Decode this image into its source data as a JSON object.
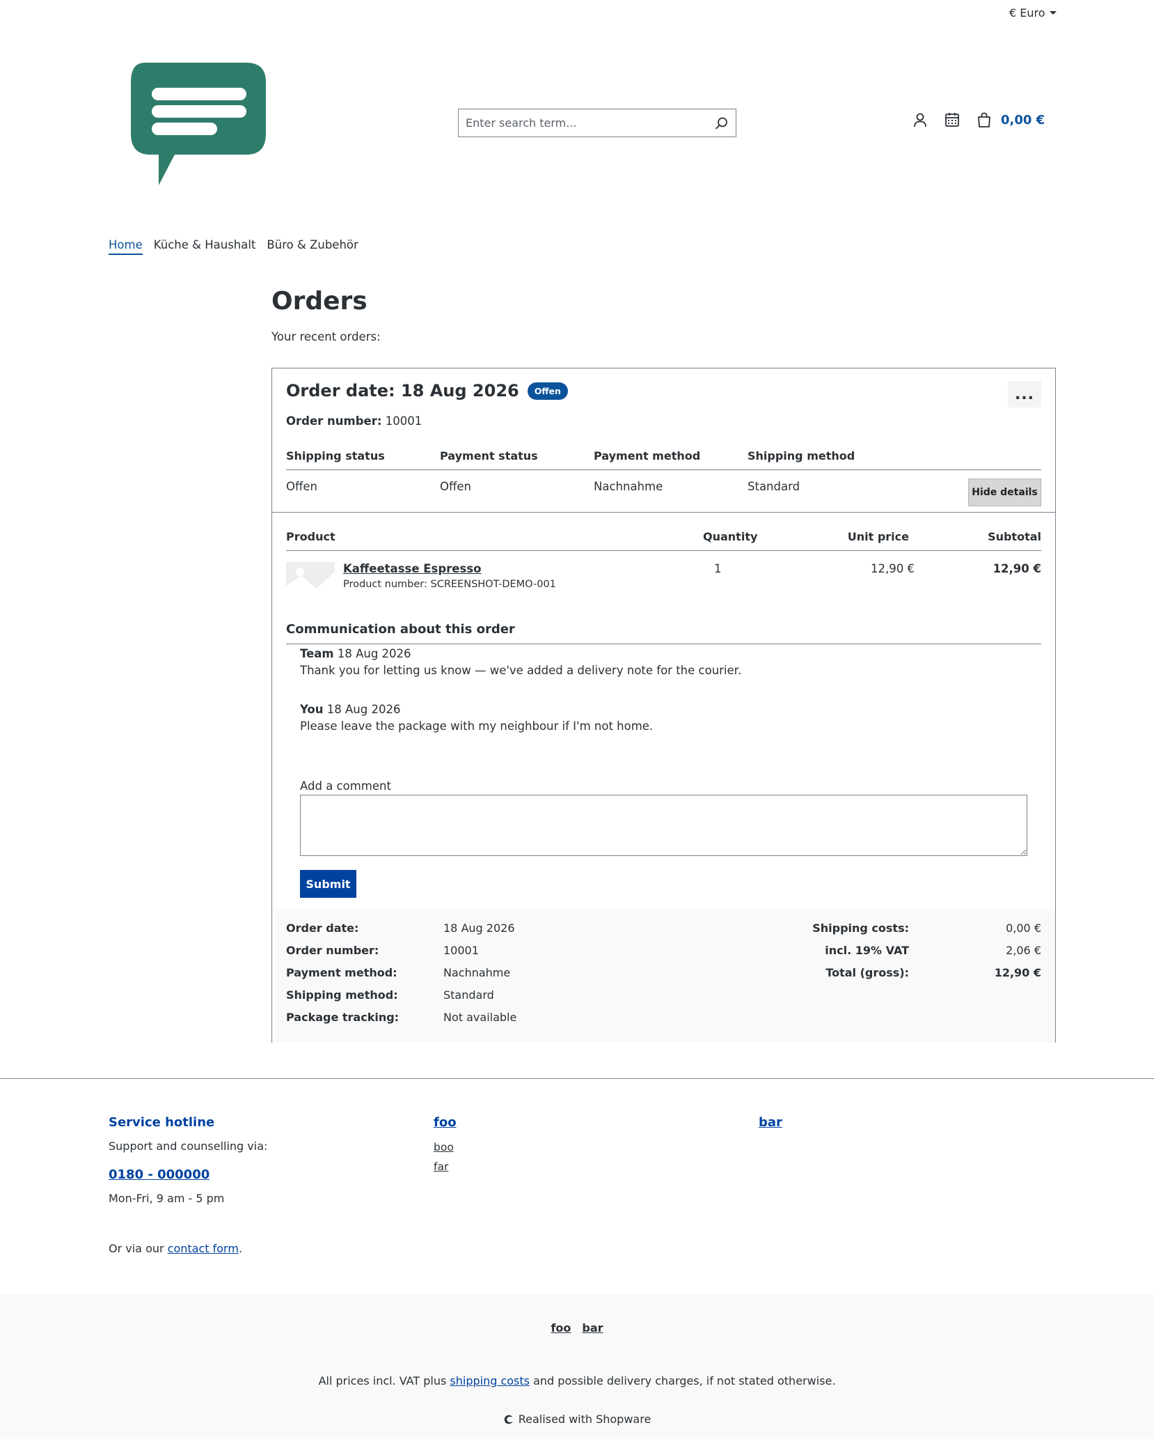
{
  "topbar": {
    "currency": "€ Euro"
  },
  "header": {
    "search_placeholder": "Enter search term...",
    "cart_total": "0,00 €"
  },
  "nav": {
    "items": [
      "Home",
      "Küche & Haushalt",
      "Büro & Zubehör"
    ]
  },
  "page": {
    "title": "Orders",
    "subtitle": "Your recent orders:"
  },
  "order": {
    "date_heading": "Order date: 18 Aug 2026",
    "status_badge": "Offen",
    "more_label": "...",
    "number_label": "Order number:",
    "number_value": "10001",
    "status_headers": [
      "Shipping status",
      "Payment status",
      "Payment method",
      "Shipping method"
    ],
    "status_values": [
      "Offen",
      "Offen",
      "Nachnahme",
      "Standard"
    ],
    "hide_details": "Hide details",
    "product_headers": {
      "product": "Product",
      "quantity": "Quantity",
      "unit_price": "Unit price",
      "subtotal": "Subtotal"
    },
    "product": {
      "name": "Kaffeetasse Espresso",
      "number": "Product number: SCREENSHOT-DEMO-001",
      "quantity": "1",
      "unit_price": "12,90 €",
      "subtotal": "12,90 €"
    },
    "communication": {
      "heading": "Communication about this order",
      "messages": [
        {
          "author": "Team",
          "date": "18 Aug 2026",
          "text": "Thank you for letting us know — we've added a delivery note for the courier."
        },
        {
          "author": "You",
          "date": "18 Aug 2026",
          "text": "Please leave the package with my neighbour if I'm not home."
        }
      ],
      "comment_label": "Add a comment",
      "submit_label": "Submit"
    },
    "summary": {
      "labels": [
        "Order date:",
        "Order number:",
        "Payment method:",
        "Shipping method:",
        "Package tracking:"
      ],
      "values": [
        "18 Aug 2026",
        "10001",
        "Nachnahme",
        "Standard",
        "Not available"
      ],
      "totals_labels": [
        "Shipping costs:",
        "incl. 19% VAT",
        "Total (gross):"
      ],
      "totals_values": [
        "0,00 €",
        "2,06 €",
        "12,90 €"
      ]
    }
  },
  "footer": {
    "hotline_title": "Service hotline",
    "hotline_text": "Support and counselling via:",
    "hotline_number": "0180 - 000000",
    "hotline_hours": "Mon-Fri, 9 am - 5 pm",
    "contact_prefix": "Or via our",
    "contact_link": "contact form",
    "contact_suffix": ".",
    "col2_title": "foo",
    "col2_links": [
      "boo",
      "far"
    ],
    "col3_title": "bar",
    "bottom_links": [
      "foo",
      "bar"
    ],
    "vat_prefix": "All prices incl. VAT plus",
    "vat_link": "shipping costs",
    "vat_suffix": "and possible delivery charges, if not stated otherwise.",
    "realised": "Realised with Shopware"
  },
  "colors": {
    "brand": "#0b539b",
    "primary_button": "#0042a0",
    "logo": "#2e7d6b"
  }
}
